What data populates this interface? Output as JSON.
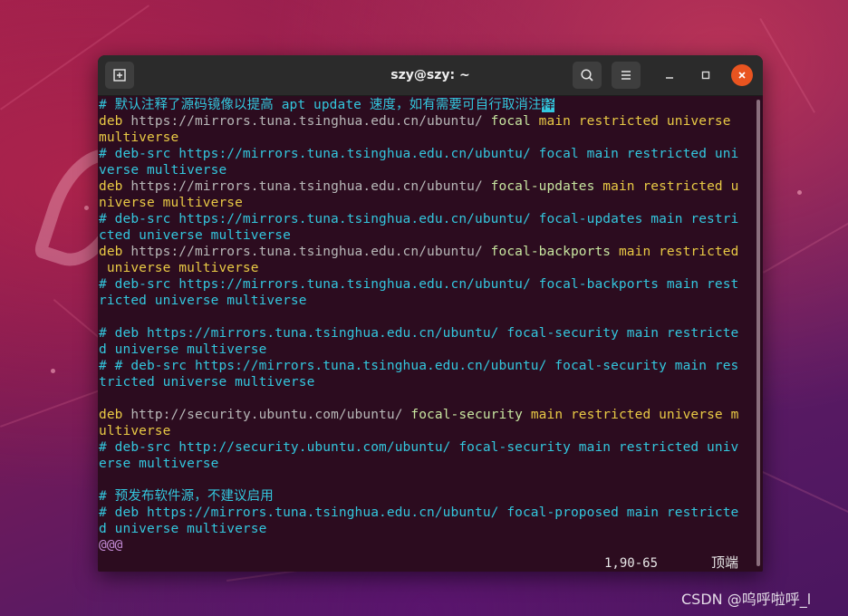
{
  "window": {
    "title": "szy@szy: ~",
    "icons": {
      "new_tab": "new-tab-icon",
      "search": "search-icon",
      "menu": "hamburger-menu-icon",
      "minimize": "minimize-icon",
      "maximize": "maximize-icon",
      "close": "close-icon"
    },
    "close_color": "#e95420"
  },
  "terminal": {
    "lines": [
      [
        {
          "t": "# 默认注释了源码镜像以提高 apt update 速度，如有需要可自行取消注",
          "c": "cyan"
        },
        {
          "t": "释",
          "c": "cursor"
        }
      ],
      [
        {
          "t": "deb ",
          "c": "yellow"
        },
        {
          "t": "https://mirrors.tuna.tsinghua.edu.cn/ubuntu/ ",
          "c": "gray"
        },
        {
          "t": "focal ",
          "c": "green"
        },
        {
          "t": "main restricted universe ",
          "c": "yellow"
        }
      ],
      [
        {
          "t": "multiverse",
          "c": "yellow"
        }
      ],
      [
        {
          "t": "# deb-src https://mirrors.tuna.tsinghua.edu.cn/ubuntu/ focal main restricted uni",
          "c": "cyan"
        }
      ],
      [
        {
          "t": "verse multiverse",
          "c": "cyan"
        }
      ],
      [
        {
          "t": "deb ",
          "c": "yellow"
        },
        {
          "t": "https://mirrors.tuna.tsinghua.edu.cn/ubuntu/ ",
          "c": "gray"
        },
        {
          "t": "focal-updates ",
          "c": "green"
        },
        {
          "t": "main restricted u",
          "c": "yellow"
        }
      ],
      [
        {
          "t": "niverse multiverse",
          "c": "yellow"
        }
      ],
      [
        {
          "t": "# deb-src https://mirrors.tuna.tsinghua.edu.cn/ubuntu/ focal-updates main restri",
          "c": "cyan"
        }
      ],
      [
        {
          "t": "cted universe multiverse",
          "c": "cyan"
        }
      ],
      [
        {
          "t": "deb ",
          "c": "yellow"
        },
        {
          "t": "https://mirrors.tuna.tsinghua.edu.cn/ubuntu/ ",
          "c": "gray"
        },
        {
          "t": "focal-backports ",
          "c": "green"
        },
        {
          "t": "main restricted",
          "c": "yellow"
        }
      ],
      [
        {
          "t": " universe multiverse",
          "c": "yellow"
        }
      ],
      [
        {
          "t": "# deb-src https://mirrors.tuna.tsinghua.edu.cn/ubuntu/ focal-backports main rest",
          "c": "cyan"
        }
      ],
      [
        {
          "t": "ricted universe multiverse",
          "c": "cyan"
        }
      ],
      [],
      [
        {
          "t": "# deb https://mirrors.tuna.tsinghua.edu.cn/ubuntu/ focal-security main restricte",
          "c": "cyan"
        }
      ],
      [
        {
          "t": "d universe multiverse",
          "c": "cyan"
        }
      ],
      [
        {
          "t": "# # deb-src https://mirrors.tuna.tsinghua.edu.cn/ubuntu/ focal-security main res",
          "c": "cyan"
        }
      ],
      [
        {
          "t": "tricted universe multiverse",
          "c": "cyan"
        }
      ],
      [],
      [
        {
          "t": "deb ",
          "c": "yellow"
        },
        {
          "t": "http://security.ubuntu.com/ubuntu/ ",
          "c": "gray"
        },
        {
          "t": "focal-security ",
          "c": "green"
        },
        {
          "t": "main restricted universe m",
          "c": "yellow"
        }
      ],
      [
        {
          "t": "ultiverse",
          "c": "yellow"
        }
      ],
      [
        {
          "t": "# deb-src http://security.ubuntu.com/ubuntu/ focal-security main restricted univ",
          "c": "cyan"
        }
      ],
      [
        {
          "t": "erse multiverse",
          "c": "cyan"
        }
      ],
      [],
      [
        {
          "t": "# 预发布软件源，不建议启用",
          "c": "cyan"
        }
      ],
      [
        {
          "t": "# deb https://mirrors.tuna.tsinghua.edu.cn/ubuntu/ focal-proposed main restricte",
          "c": "cyan"
        }
      ],
      [
        {
          "t": "d universe multiverse",
          "c": "cyan"
        }
      ],
      [
        {
          "t": "@@@",
          "c": "purple"
        }
      ]
    ],
    "colors": {
      "background": "#2c0c1f",
      "cyan": "#33c7de",
      "yellow": "#e9ca45",
      "gray": "#b8b8b8",
      "green": "#c8e6a0",
      "purple": "#c38bd6"
    },
    "status": {
      "position": "1,90-65",
      "scroll": "顶端"
    }
  },
  "watermark": "CSDN @呜呼啦呼_l"
}
